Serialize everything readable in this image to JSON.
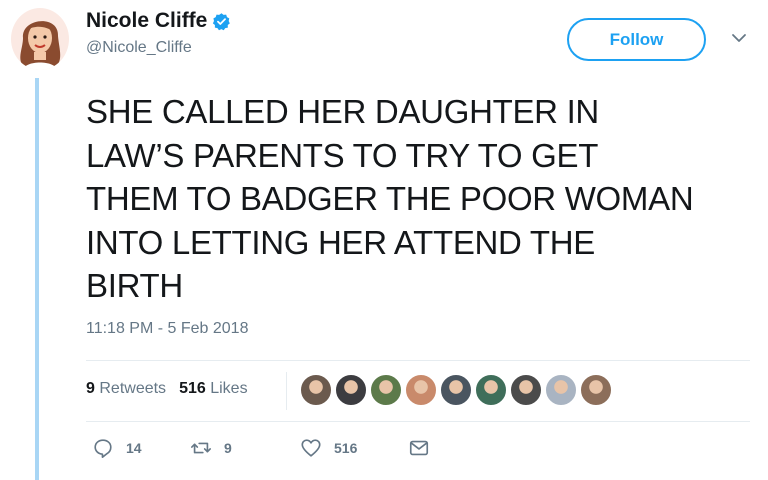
{
  "author": {
    "name": "Nicole Cliffe",
    "handle": "@Nicole_Cliffe",
    "verified": true,
    "avatar_icon": "avatar-illustration"
  },
  "follow_label": "Follow",
  "tweet": {
    "text": "SHE CALLED HER DAUGHTER IN\nLAW’S PARENTS TO TRY TO GET\nTHEM TO BADGER THE POOR WOMAN\nINTO LETTING HER ATTEND THE\nBIRTH",
    "timestamp": "11:18 PM - 5 Feb 2018"
  },
  "stats": {
    "retweets_count": "9",
    "retweets_label": "Retweets",
    "likes_count": "516",
    "likes_label": "Likes"
  },
  "likers": [
    {
      "color": "#6b5a4e"
    },
    {
      "color": "#3c3c40"
    },
    {
      "color": "#5c7a4a"
    },
    {
      "color": "#c98a6b"
    },
    {
      "color": "#4a5560"
    },
    {
      "color": "#3f6e5a"
    },
    {
      "color": "#4b4b4b"
    },
    {
      "color": "#a9b4c2"
    },
    {
      "color": "#8c6e5a"
    }
  ],
  "actions": {
    "reply_count": "14",
    "retweet_count": "9",
    "like_count": "516"
  },
  "colors": {
    "accent": "#1da1f2",
    "thread_line": "#a9d6f5",
    "secondary_text": "#657786"
  }
}
